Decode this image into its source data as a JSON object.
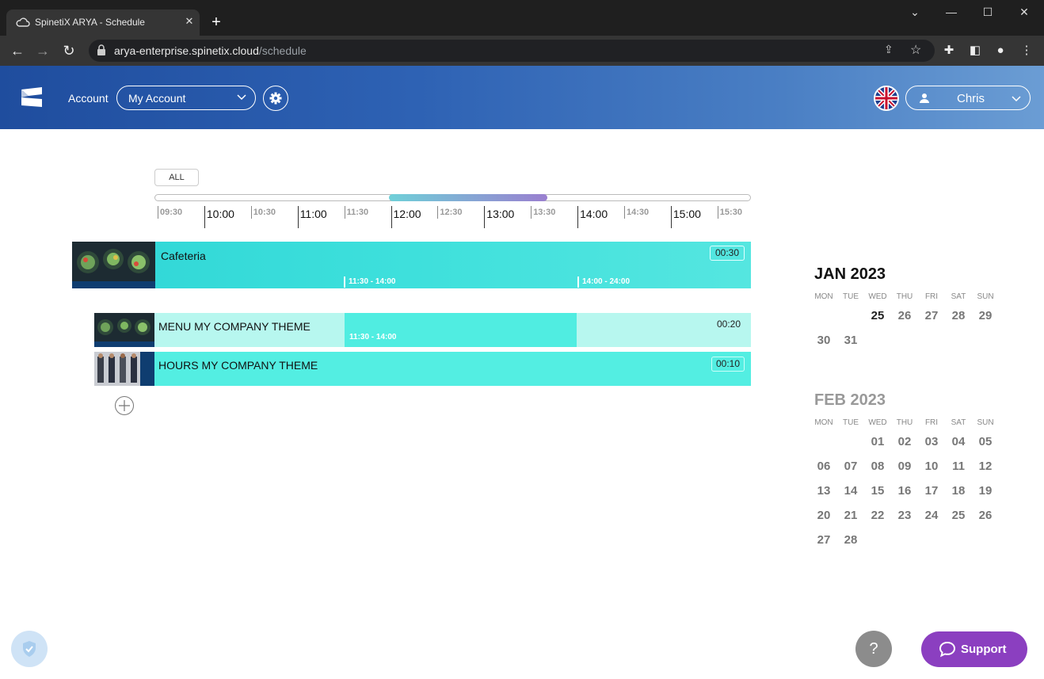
{
  "browser": {
    "tab_title": "SpinetiX ARYA - Schedule",
    "tab_close": "✕",
    "new_tab": "+",
    "url_domain": "arya-enterprise.spinetix.cloud",
    "url_path": "/schedule"
  },
  "header": {
    "account_label": "Account",
    "account_value": "My Account",
    "user_name": "Chris"
  },
  "timeline": {
    "all_label": "ALL",
    "ticks": [
      {
        "label": "09:30",
        "kind": "minor"
      },
      {
        "label": "10:00",
        "kind": "major"
      },
      {
        "label": "10:30",
        "kind": "minor"
      },
      {
        "label": "11:00",
        "kind": "major"
      },
      {
        "label": "11:30",
        "kind": "minor"
      },
      {
        "label": "12:00",
        "kind": "major"
      },
      {
        "label": "12:30",
        "kind": "minor"
      },
      {
        "label": "13:00",
        "kind": "major"
      },
      {
        "label": "13:30",
        "kind": "minor"
      },
      {
        "label": "14:00",
        "kind": "major"
      },
      {
        "label": "14:30",
        "kind": "minor"
      },
      {
        "label": "15:00",
        "kind": "major"
      },
      {
        "label": "15:30",
        "kind": "minor"
      }
    ]
  },
  "playlist": {
    "name": "Cafeteria",
    "duration": "00:30",
    "slots": [
      "11:30 - 14:00",
      "14:00 - 24:00"
    ],
    "items": [
      {
        "title": "MENU MY COMPANY THEME",
        "duration": "00:20",
        "slot": "11:30 - 14:00"
      },
      {
        "title": "HOURS MY COMPANY THEME",
        "duration": "00:10"
      }
    ]
  },
  "calendar": {
    "day_names": [
      "MON",
      "TUE",
      "WED",
      "THU",
      "FRI",
      "SAT",
      "SUN"
    ],
    "months": [
      {
        "title": "JAN 2023",
        "weeks": [
          [
            "",
            "",
            "25",
            "26",
            "27",
            "28",
            "29"
          ],
          [
            "30",
            "31",
            "",
            "",
            "",
            "",
            ""
          ]
        ]
      },
      {
        "title": "FEB 2023",
        "weeks": [
          [
            "",
            "",
            "01",
            "02",
            "03",
            "04",
            "05"
          ],
          [
            "06",
            "07",
            "08",
            "09",
            "10",
            "11",
            "12"
          ],
          [
            "13",
            "14",
            "15",
            "16",
            "17",
            "18",
            "19"
          ],
          [
            "20",
            "21",
            "22",
            "23",
            "24",
            "25",
            "26"
          ],
          [
            "27",
            "28",
            "",
            "",
            "",
            "",
            ""
          ]
        ]
      }
    ]
  },
  "footer": {
    "help_label": "?",
    "support_label": "Support"
  }
}
